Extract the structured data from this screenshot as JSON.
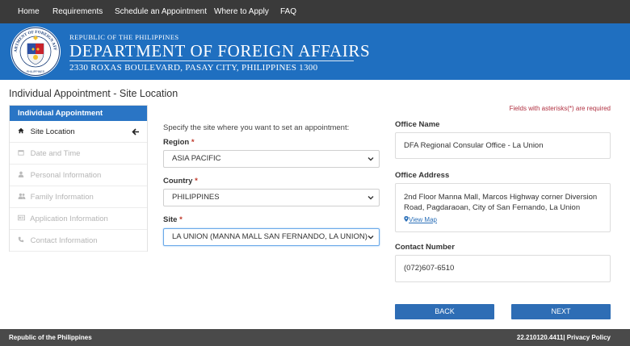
{
  "nav": {
    "items": [
      "Home",
      "Requirements",
      "Schedule an Appointment",
      "Where to Apply",
      "FAQ"
    ]
  },
  "banner": {
    "republic": "REPUBLIC OF THE PHILIPPINES",
    "department": "DEPARTMENT OF FOREIGN AFFAIRS",
    "address": "2330 ROXAS BOULEVARD, PASAY CITY, PHILIPPINES 1300",
    "seal_text": "DEPARTMENT OF FOREIGN AFFAIRS",
    "seal_bottom": "PHILIPPINES"
  },
  "page": {
    "title": "Individual Appointment - Site Location"
  },
  "sidebar": {
    "header": "Individual Appointment",
    "items": [
      {
        "label": "Site Location",
        "icon": "home-icon",
        "active": true
      },
      {
        "label": "Date and Time",
        "icon": "calendar-icon",
        "active": false
      },
      {
        "label": "Personal Information",
        "icon": "user-icon",
        "active": false
      },
      {
        "label": "Family Information",
        "icon": "users-icon",
        "active": false
      },
      {
        "label": "Application Information",
        "icon": "id-card-icon",
        "active": false
      },
      {
        "label": "Contact Information",
        "icon": "phone-icon",
        "active": false
      }
    ]
  },
  "form": {
    "intro": "Specify the site where you want to set an appointment:",
    "required_note": "Fields with asterisks(*) are required",
    "region_label": "Region",
    "region_value": "ASIA PACIFIC",
    "country_label": "Country",
    "country_value": "PHILIPPINES",
    "site_label": "Site",
    "site_value": "LA UNION (MANNA MALL SAN FERNANDO, LA UNION)",
    "asterisk": "*"
  },
  "office": {
    "name_label": "Office Name",
    "name_value": "DFA Regional Consular Office - La Union",
    "address_label": "Office Address",
    "address_line1": "2nd Floor Manna Mall, Marcos Highway corner Diversion",
    "address_line2": "Road, Pagdaraoan, City of San Fernando, La Union",
    "view_map": "View Map",
    "contact_label": "Contact Number",
    "contact_value": "(072)607-6510"
  },
  "buttons": {
    "back": "BACK",
    "next": "NEXT"
  },
  "footer": {
    "left": "Republic of the Philippines",
    "right": "22.210120.4411| Privacy Policy"
  },
  "colors": {
    "banner": "#1f6fc0",
    "nav": "#3a3a3a",
    "button": "#2e6db5",
    "required": "#c0392b"
  }
}
